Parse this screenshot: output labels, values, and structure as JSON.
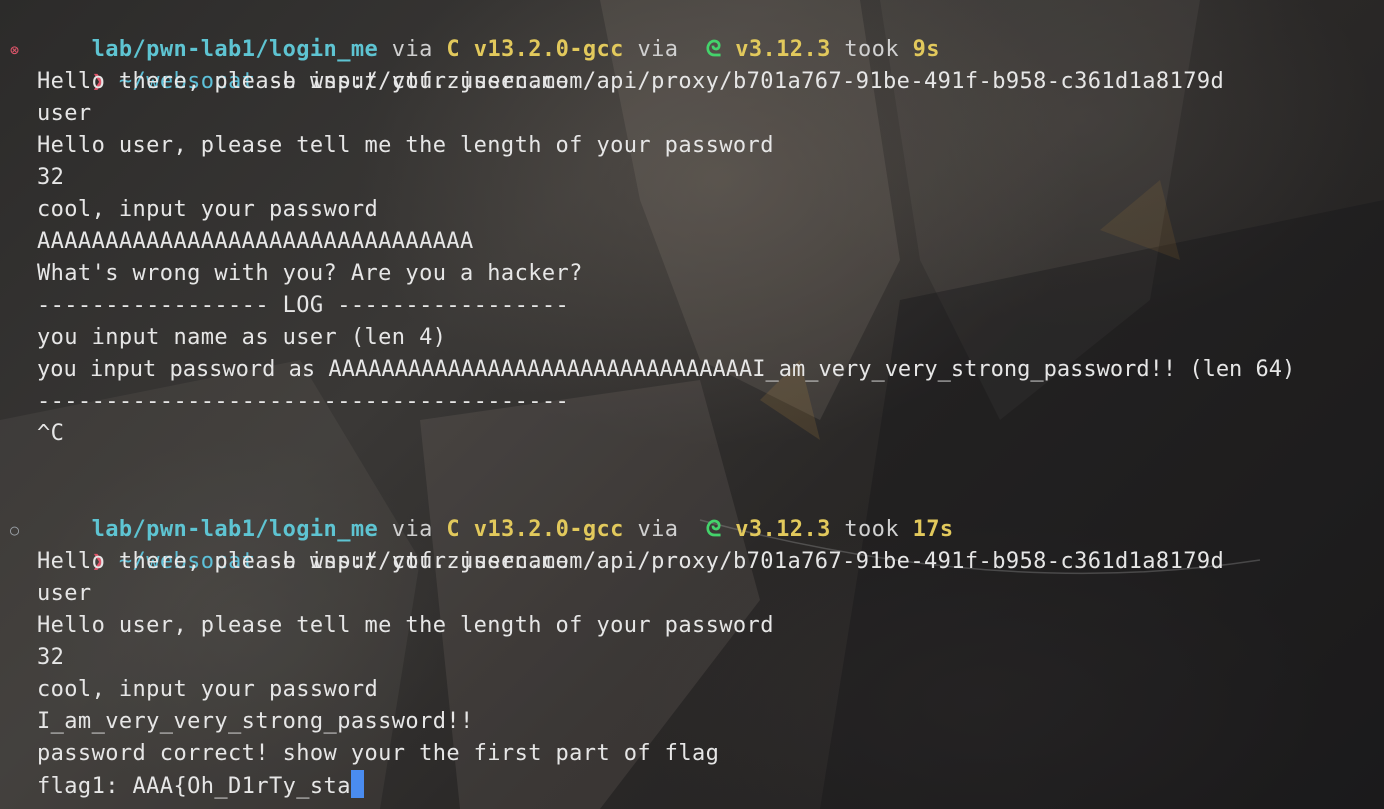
{
  "blocks": [
    {
      "prompt": {
        "dir": "lab/pwn-lab1/login_me",
        "via1": " via ",
        "lang_icon": "C",
        "lang_ver": " v13.2.0-gcc",
        "via2": " via ",
        "py_icon": "python-icon",
        "py_ver": " v3.12.3",
        "took": " took ",
        "duration": "9s"
      },
      "status": "error",
      "status_glyph": "⊗",
      "arrow": "❯",
      "command_path": "~/websocat",
      "command_args": " -b wss://ctf.zjusec.com/api/proxy/b701a767-91be-491f-b958-c361d1a8179d",
      "output": [
        "Hello there, please input your username",
        "user",
        "Hello user, please tell me the length of your password",
        "32",
        "cool, input your password",
        "AAAAAAAAAAAAAAAAAAAAAAAAAAAAAAAA",
        "What's wrong with you? Are you a hacker?",
        "----------------- LOG -----------------",
        "you input name as user (len 4)",
        "you input password as AAAAAAAAAAAAAAAAAAAAAAAAAAAAAAAAI_am_very_very_strong_password!! (len 64)",
        "---------------------------------------",
        "^C"
      ]
    },
    {
      "prompt": {
        "dir": "lab/pwn-lab1/login_me",
        "via1": " via ",
        "lang_icon": "C",
        "lang_ver": " v13.2.0-gcc",
        "via2": " via ",
        "py_icon": "python-icon",
        "py_ver": " v3.12.3",
        "took": " took ",
        "duration": "17s"
      },
      "status": "running",
      "status_glyph": "○",
      "arrow": "❯",
      "command_path": "~/websocat",
      "command_args": " -b wss://ctf.zjusec.com/api/proxy/b701a767-91be-491f-b958-c361d1a8179d",
      "output": [
        "Hello there, please input your username",
        "user",
        "Hello user, please tell me the length of your password",
        "32",
        "cool, input your password",
        "I_am_very_very_strong_password!!",
        "password correct! show your the first part of flag",
        "flag1: AAA{Oh_D1rTy_sta"
      ]
    }
  ],
  "colors": {
    "dir": "#5ec4d2",
    "accent_yellow": "#e2c95c",
    "error_red": "#e0566b",
    "python_green": "#44d36b",
    "cursor_blue": "#4a8cf0"
  }
}
